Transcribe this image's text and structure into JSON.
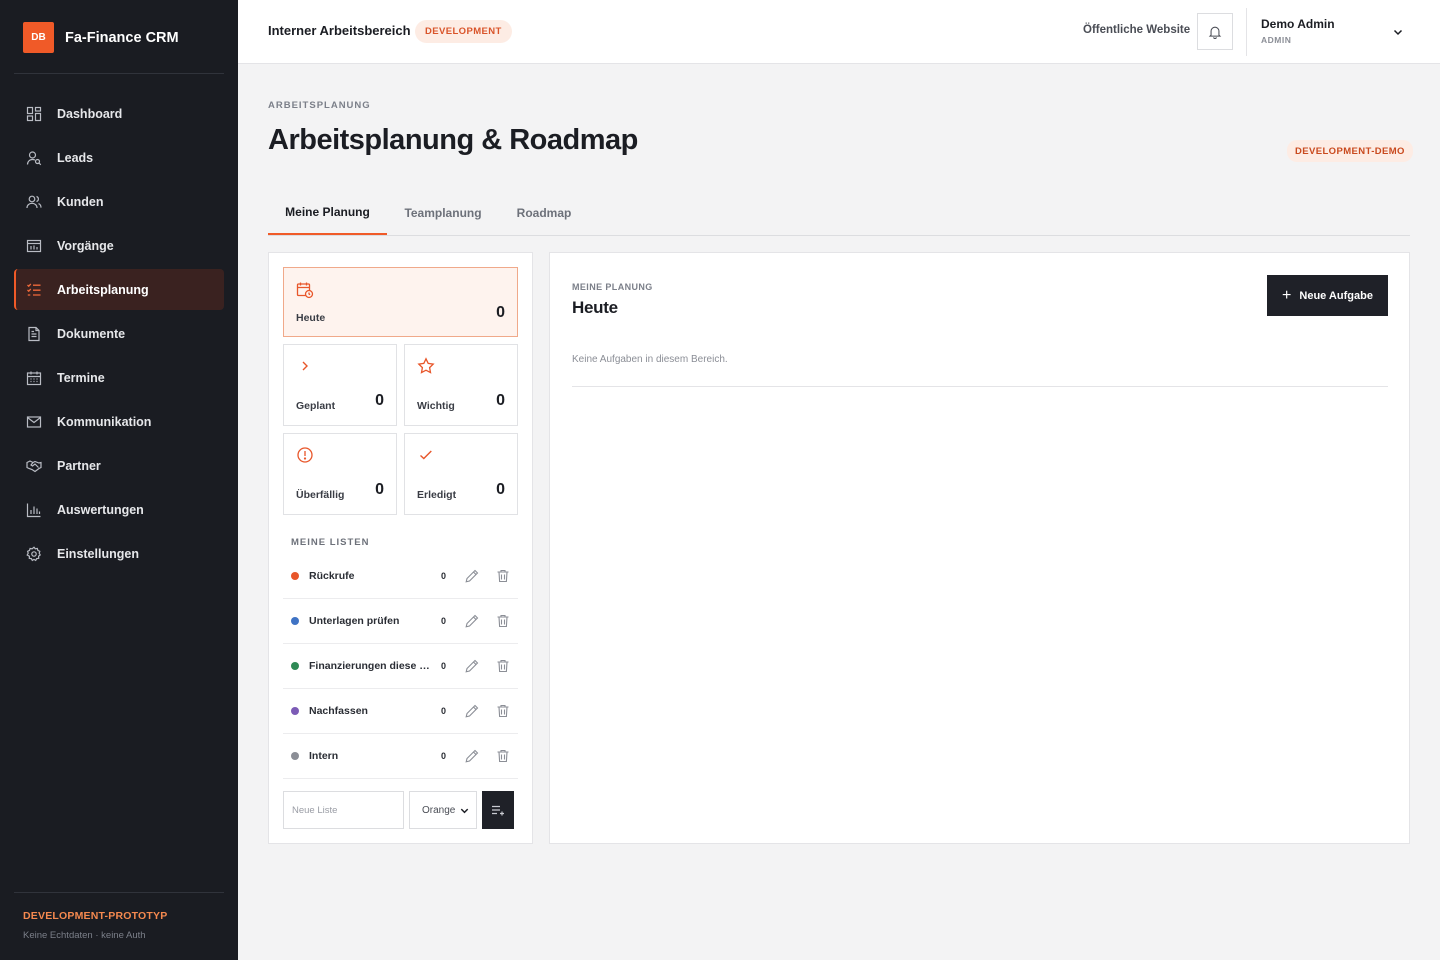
{
  "brand": {
    "logo": "DB",
    "name": "Fa-Finance CRM"
  },
  "sidebar": {
    "items": [
      {
        "label": "Dashboard",
        "icon": "dashboard-icon"
      },
      {
        "label": "Leads",
        "icon": "lead-search-icon"
      },
      {
        "label": "Kunden",
        "icon": "users-icon"
      },
      {
        "label": "Vorgänge",
        "icon": "pipeline-icon"
      },
      {
        "label": "Arbeitsplanung",
        "icon": "tasklist-icon",
        "active": true
      },
      {
        "label": "Dokumente",
        "icon": "document-icon"
      },
      {
        "label": "Termine",
        "icon": "calendar-icon"
      },
      {
        "label": "Kommunikation",
        "icon": "mail-icon"
      },
      {
        "label": "Partner",
        "icon": "handshake-icon"
      },
      {
        "label": "Auswertungen",
        "icon": "bar-chart-icon"
      },
      {
        "label": "Einstellungen",
        "icon": "gear-icon"
      }
    ],
    "footer_title": "DEVELOPMENT-PROTOTYP",
    "footer_sub": "Keine Echtdaten · keine Auth"
  },
  "topbar": {
    "workspace": "Interner Arbeitsbereich",
    "env_badge": "DEVELOPMENT",
    "public_link": "Öffentliche Website",
    "user_name": "Demo Admin",
    "user_role": "ADMIN"
  },
  "header": {
    "breadcrumb": "ARBEITSPLANUNG",
    "title": "Arbeitsplanung & Roadmap",
    "badge": "DEVELOPMENT-DEMO"
  },
  "tabs": [
    {
      "label": "Meine Planung",
      "active": true
    },
    {
      "label": "Teamplanung"
    },
    {
      "label": "Roadmap"
    }
  ],
  "stats": {
    "heute": {
      "label": "Heute",
      "value": "0"
    },
    "geplant": {
      "label": "Geplant",
      "value": "0"
    },
    "wichtig": {
      "label": "Wichtig",
      "value": "0"
    },
    "ueberfaellig": {
      "label": "Überfällig",
      "value": "0"
    },
    "erledigt": {
      "label": "Erledigt",
      "value": "0"
    }
  },
  "lists": {
    "title": "MEINE LISTEN",
    "items": [
      {
        "name": "Rückrufe",
        "count": "0",
        "color": "#e8562a"
      },
      {
        "name": "Unterlagen prüfen",
        "count": "0",
        "color": "#3f73c4"
      },
      {
        "name": "Finanzierungen diese Woche",
        "count": "0",
        "color": "#2f8a55"
      },
      {
        "name": "Nachfassen",
        "count": "0",
        "color": "#7c5bb6"
      },
      {
        "name": "Intern",
        "count": "0",
        "color": "#8b8e96"
      }
    ],
    "new_placeholder": "Neue Liste",
    "new_value": "",
    "color_selected": "Orange"
  },
  "planning": {
    "eyebrow": "MEINE PLANUNG",
    "title": "Heute",
    "new_task_label": "Neue Aufgabe",
    "empty_text": "Keine Aufgaben in diesem Bereich."
  },
  "colors": {
    "accent": "#f05a28",
    "sidebar_bg": "#1a1c22",
    "dark_button": "#1f2128"
  }
}
